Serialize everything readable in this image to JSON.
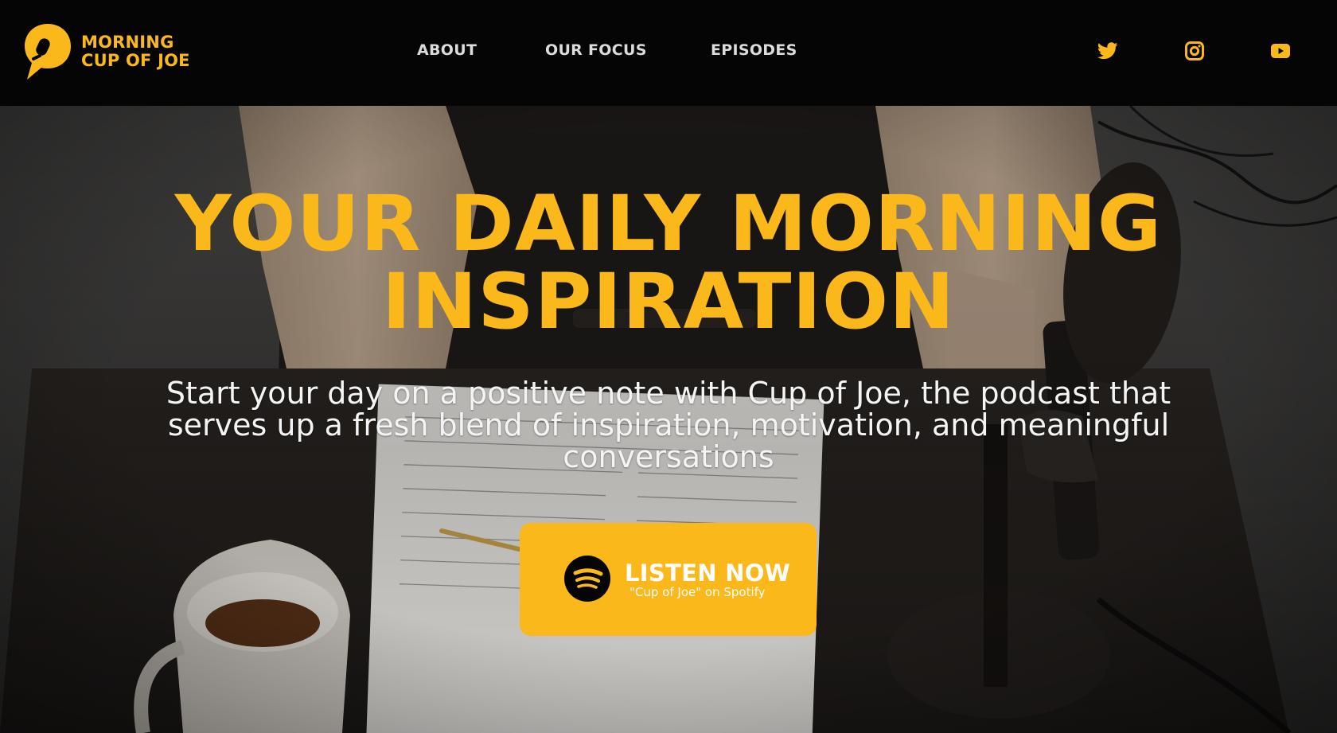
{
  "brand": {
    "line1": "MORNING",
    "line2": "CUP OF JOE",
    "color": "#fbb81a",
    "icon": "microphone-bubble-icon"
  },
  "nav": {
    "items": [
      {
        "label": "ABOUT"
      },
      {
        "label": "OUR FOCUS"
      },
      {
        "label": "EPISODES"
      }
    ]
  },
  "social": [
    {
      "icon": "twitter-icon"
    },
    {
      "icon": "instagram-icon"
    },
    {
      "icon": "youtube-icon"
    }
  ],
  "hero": {
    "headline_line1": "YOUR DAILY MORNING",
    "headline_line2": "INSPIRATION",
    "subhead_line1": "Start your day on a positive note with Cup of Joe, the podcast that",
    "subhead_line2": "serves up a fresh blend of inspiration, motivation, and meaningful",
    "subhead_line3": "conversations"
  },
  "cta": {
    "title": "LISTEN NOW",
    "subtitle": "\"Cup of Joe\" on Spotify",
    "icon": "spotify-icon",
    "color": "#fbb81a"
  }
}
